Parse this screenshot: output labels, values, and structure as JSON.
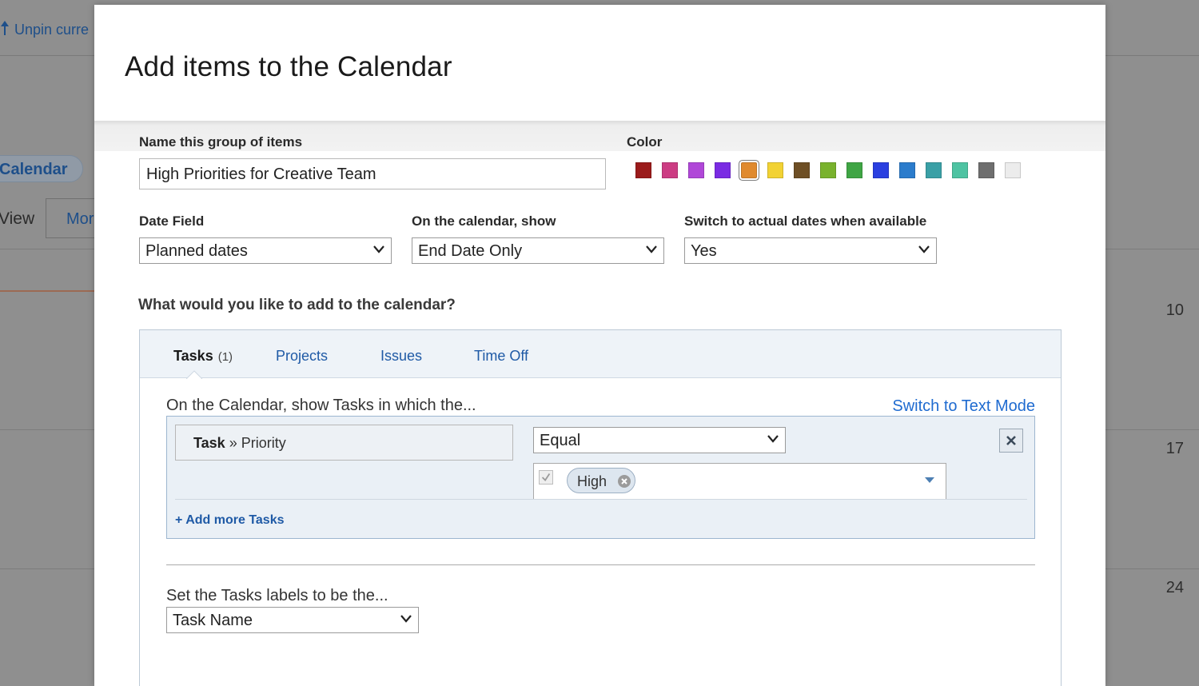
{
  "background": {
    "unpin_label": "Unpin curre",
    "calendar_pill": "Calendar",
    "view_label": "View",
    "mo_button": "Mor",
    "day_numbers": [
      "10",
      "17",
      "24"
    ]
  },
  "modal": {
    "title": "Add items to the Calendar",
    "group_name": {
      "label": "Name this group of items",
      "value": "High Priorities for Creative Team"
    },
    "color": {
      "label": "Color",
      "swatches": [
        "#9b1b1b",
        "#cc3c83",
        "#b047d8",
        "#7a2be3",
        "#e08a2e",
        "#f2d233",
        "#6e4f25",
        "#79b22d",
        "#3fa544",
        "#2a3fe0",
        "#2b7ccc",
        "#3aa0a6",
        "#4ec3a2",
        "#6e6e6e",
        "#ececec"
      ],
      "selected": "#e08a2e"
    },
    "date_field": {
      "label": "Date Field",
      "value": "Planned dates"
    },
    "calendar_show": {
      "label": "On the calendar, show",
      "value": "End Date Only"
    },
    "actual_dates": {
      "label": "Switch to actual dates when available",
      "value": "Yes"
    },
    "question": "What would you like to add to the calendar?",
    "tabs": [
      {
        "label": "Tasks",
        "count": "(1)"
      },
      {
        "label": "Projects"
      },
      {
        "label": "Issues"
      },
      {
        "label": "Time Off"
      }
    ],
    "filter": {
      "intro": "On the Calendar, show Tasks in which the...",
      "switch_mode": "Switch to Text Mode",
      "field_object": "Task",
      "field_sep": "»",
      "field_name": "Priority",
      "operator": "Equal",
      "chip": "High",
      "add_more": "+ Add more Tasks"
    },
    "labels": {
      "intro": "Set the Tasks labels to be the...",
      "value": "Task Name"
    }
  }
}
